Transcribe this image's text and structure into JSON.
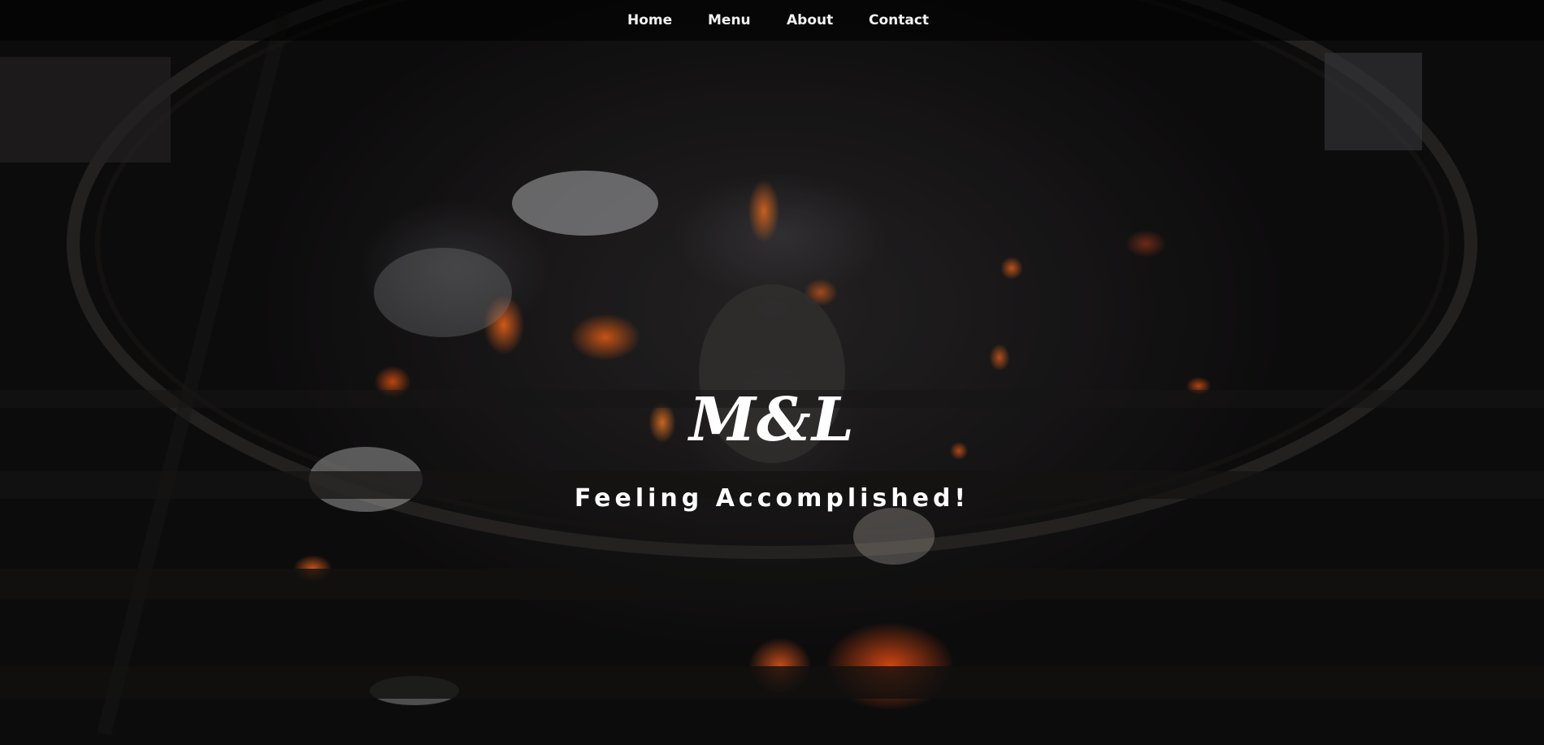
{
  "nav": {
    "items": [
      {
        "label": "Home"
      },
      {
        "label": "Menu"
      },
      {
        "label": "About"
      },
      {
        "label": "Contact"
      }
    ]
  },
  "hero": {
    "brand": "M&L",
    "tagline": "Feeling Accomplished!",
    "background_image": "burning-charcoal-grill-photo"
  },
  "colors": {
    "nav_text": "#f2f2f2",
    "hero_text": "#ffffff",
    "ember": "#ff6a1a"
  }
}
